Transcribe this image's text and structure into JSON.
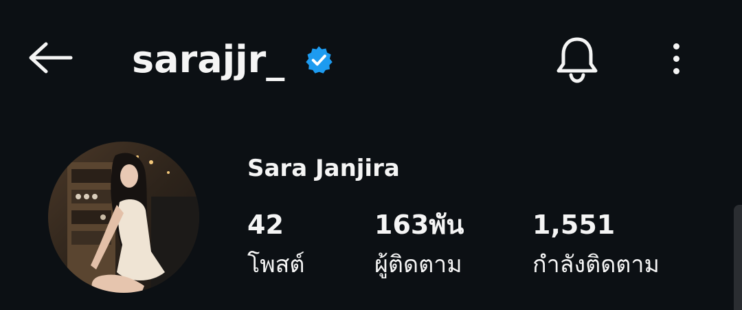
{
  "header": {
    "username": "sarajjr_",
    "verified": true,
    "icons": {
      "back": "back-arrow-icon",
      "verified": "verified-badge-icon",
      "notifications": "bell-icon",
      "more": "more-vertical-icon"
    }
  },
  "profile": {
    "full_name": "Sara Janjira",
    "avatar": "profile-photo"
  },
  "stats": {
    "posts": {
      "value": "42",
      "label": "โพสต์"
    },
    "followers": {
      "value": "163พัน",
      "label": "ผู้ติดตาม"
    },
    "following": {
      "value": "1,551",
      "label": "กำลังติดตาม"
    }
  },
  "colors": {
    "background": "#0c1014",
    "text": "#f5f5f5",
    "verified_blue": "#1d9bf0"
  }
}
